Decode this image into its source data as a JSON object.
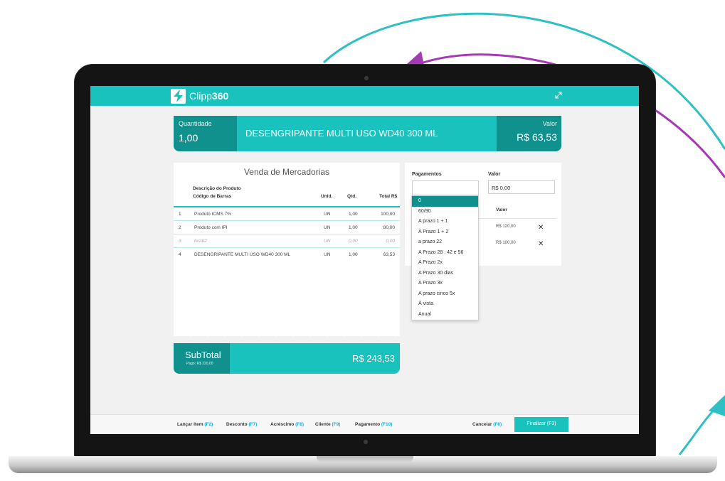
{
  "colors": {
    "accent": "#19c2bd",
    "accent_dark": "#10918d",
    "arc_teal": "#2fc0c5",
    "arc_purple": "#a53ab4"
  },
  "app": {
    "logo_text_light": "Clipp",
    "logo_text_bold": "360"
  },
  "banner": {
    "quantity_label": "Quantidade",
    "quantity_value": "1,00",
    "product_name": "DESENGRIPANTE MULTI USO WD40 300 ML",
    "value_label": "Valor",
    "value_amount": "R$ 63,53"
  },
  "receipt": {
    "title": "Venda de Mercadorias",
    "columns": {
      "desc1": "Descrição do Produto",
      "desc2": "Código de Barras",
      "unit": "Unid.",
      "qty": "Qtd.",
      "total": "Total R$"
    },
    "rows": [
      {
        "n": "1",
        "name": "Produto ICMS 7%",
        "unit": "UN",
        "qty": "1,00",
        "total": "100,00",
        "cancelled": false
      },
      {
        "n": "2",
        "name": "Produto com IPI",
        "unit": "UN",
        "qty": "1,00",
        "total": "80,00",
        "cancelled": false
      },
      {
        "n": "3",
        "name": "teste2",
        "unit": "UN",
        "qty": "0,00",
        "total": "0,00",
        "cancelled": true
      },
      {
        "n": "4",
        "name": "DESENGRIPANTE MULTI USO WD40 300 ML",
        "unit": "UN",
        "qty": "1,00",
        "total": "63,53",
        "cancelled": false
      }
    ]
  },
  "subtotal": {
    "label": "SubTotal",
    "paid": "Pago: R$ 220,00",
    "value": "R$ 243,53"
  },
  "payments": {
    "label": "Pagamentos",
    "value_label": "Valor",
    "value_input": "R$ 0,00",
    "value_column": "Valor",
    "entries": [
      {
        "amount": "R$ 120,00",
        "remove": "✕"
      },
      {
        "amount": "R$ 100,00",
        "remove": "✕"
      }
    ],
    "options": [
      "0",
      "60/90",
      "A prazo 1 + 1",
      "A Prazo 1 + 2",
      "a prazo 22",
      "A Prazo 28 , 42 e 56",
      "A Prazo 2x",
      "A Prazo 30 dias",
      "A Prazo 3x",
      "A prazo cinco 5x",
      "À vista",
      "Anual"
    ],
    "highlighted_option": "0"
  },
  "footer": {
    "items": [
      {
        "label": "Lançar Item",
        "key": "(F2)"
      },
      {
        "label": "Desconto",
        "key": "(F7)"
      },
      {
        "label": "Acréscimo",
        "key": "(F8)"
      },
      {
        "label": "Cliente",
        "key": "(F9)"
      },
      {
        "label": "Pagamento",
        "key": "(F10)"
      }
    ],
    "cancel": {
      "label": "Cancelar",
      "key": "(F6)"
    },
    "finalize": "Finalizar (F3)"
  },
  "icons": {
    "logo": "clipp-logo-icon",
    "expand": "expand-icon",
    "remove": "close-icon"
  }
}
